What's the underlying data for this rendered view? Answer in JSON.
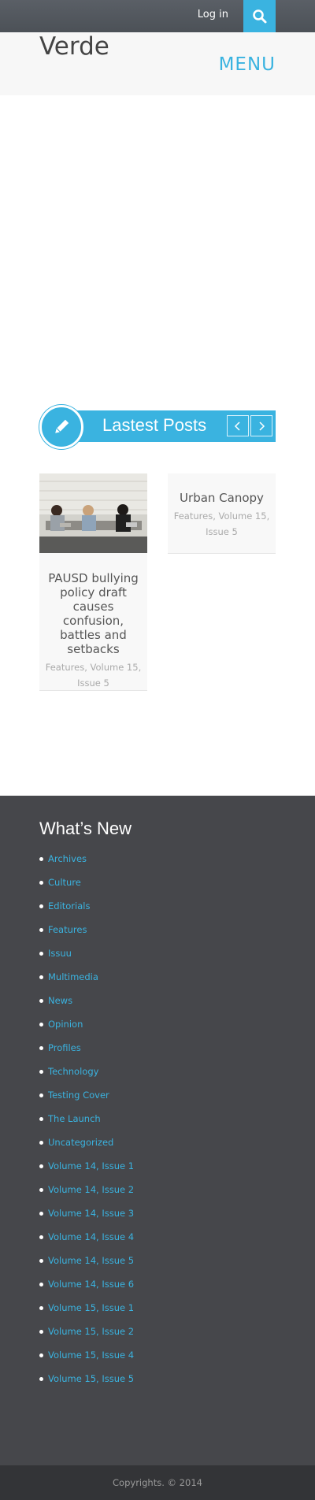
{
  "topbar": {
    "login_label": "Log in",
    "search_icon": "search-icon"
  },
  "header": {
    "site_title": "Verde",
    "menu_label": "MENU"
  },
  "posts": {
    "section_title": "Lastest Posts",
    "prev_icon": "chevron-left-icon",
    "next_icon": "chevron-right-icon",
    "items": [
      {
        "title": "PAUSD bullying policy draft causes confusion, battles and setbacks",
        "meta": "Features, Volume 15, Issue 5"
      },
      {
        "title": "Urban Canopy",
        "meta": "Features, Volume 15, Issue 5"
      }
    ]
  },
  "widget": {
    "title": "What’s New",
    "categories": [
      "Archives",
      "Culture",
      "Editorials",
      "Features",
      "Issuu",
      "Multimedia",
      "News",
      "Opinion",
      "Profiles",
      "Technology",
      "Testing Cover",
      "The Launch",
      "Uncategorized",
      "Volume 14, Issue 1",
      "Volume 14, Issue 2",
      "Volume 14, Issue 3",
      "Volume 14, Issue 4",
      "Volume 14, Issue 5",
      "Volume 14, Issue 6",
      "Volume 15, Issue 1",
      "Volume 15, Issue 2",
      "Volume 15, Issue 4",
      "Volume 15, Issue 5"
    ]
  },
  "footer": {
    "copyright": "Copyrights. © 2014"
  },
  "colors": {
    "accent": "#3ab3e0",
    "topbar": "#53585e",
    "widget_bg": "#46474b",
    "footer_bg": "#333437"
  }
}
